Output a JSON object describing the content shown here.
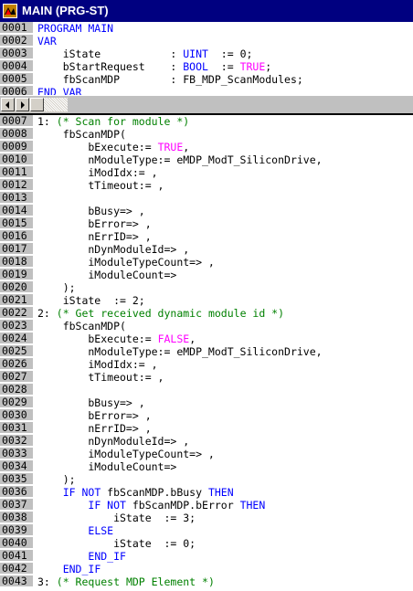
{
  "window": {
    "title": "MAIN (PRG-ST)"
  },
  "colors": {
    "keyword": "#0000ff",
    "literal": "#ff00ff",
    "comment": "#008000",
    "title_bar": "#000080",
    "gutter": "#c0c0c0"
  },
  "declaration": {
    "lines": [
      {
        "n": "0001",
        "seg": [
          {
            "t": "PROGRAM MAIN",
            "c": "kw"
          }
        ]
      },
      {
        "n": "0002",
        "seg": [
          {
            "t": "VAR",
            "c": "kw"
          }
        ]
      },
      {
        "n": "0003",
        "seg": [
          {
            "t": "    iState           : "
          },
          {
            "t": "UINT",
            "c": "kw"
          },
          {
            "t": "  := 0;"
          }
        ]
      },
      {
        "n": "0004",
        "seg": [
          {
            "t": "    bStartRequest    : "
          },
          {
            "t": "BOOL",
            "c": "kw"
          },
          {
            "t": "  := "
          },
          {
            "t": "TRUE",
            "c": "tru"
          },
          {
            "t": ";"
          }
        ]
      },
      {
        "n": "0005",
        "seg": [
          {
            "t": "    fbScanMDP        : FB_MDP_ScanModules;"
          }
        ]
      },
      {
        "n": "0006",
        "seg": [
          {
            "t": "END_VAR",
            "c": "kw"
          }
        ]
      }
    ]
  },
  "body": {
    "lines": [
      {
        "n": "0007",
        "seg": [
          {
            "t": "1: "
          },
          {
            "t": "(* Scan for module *)",
            "c": "cmt"
          }
        ]
      },
      {
        "n": "0008",
        "seg": [
          {
            "t": "    fbScanMDP("
          }
        ]
      },
      {
        "n": "0009",
        "seg": [
          {
            "t": "        bExecute:= "
          },
          {
            "t": "TRUE",
            "c": "tru"
          },
          {
            "t": ","
          }
        ]
      },
      {
        "n": "0010",
        "seg": [
          {
            "t": "        nModuleType:= eMDP_ModT_SiliconDrive,"
          }
        ]
      },
      {
        "n": "0011",
        "seg": [
          {
            "t": "        iModIdx:= ,"
          }
        ]
      },
      {
        "n": "0012",
        "seg": [
          {
            "t": "        tTimeout:= ,"
          }
        ]
      },
      {
        "n": "0013",
        "seg": [
          {
            "t": ""
          }
        ]
      },
      {
        "n": "0014",
        "seg": [
          {
            "t": "        bBusy=> ,"
          }
        ]
      },
      {
        "n": "0015",
        "seg": [
          {
            "t": "        bError=> ,"
          }
        ]
      },
      {
        "n": "0016",
        "seg": [
          {
            "t": "        nErrID=> ,"
          }
        ]
      },
      {
        "n": "0017",
        "seg": [
          {
            "t": "        nDynModuleId=> ,"
          }
        ]
      },
      {
        "n": "0018",
        "seg": [
          {
            "t": "        iModuleTypeCount=> ,"
          }
        ]
      },
      {
        "n": "0019",
        "seg": [
          {
            "t": "        iModuleCount=>"
          }
        ]
      },
      {
        "n": "0020",
        "seg": [
          {
            "t": "    );"
          }
        ]
      },
      {
        "n": "0021",
        "seg": [
          {
            "t": "    iState  := 2;"
          }
        ]
      },
      {
        "n": "0022",
        "seg": [
          {
            "t": "2: "
          },
          {
            "t": "(* Get received dynamic module id *)",
            "c": "cmt"
          }
        ]
      },
      {
        "n": "0023",
        "seg": [
          {
            "t": "    fbScanMDP("
          }
        ]
      },
      {
        "n": "0024",
        "seg": [
          {
            "t": "        bExecute:= "
          },
          {
            "t": "FALSE",
            "c": "tru"
          },
          {
            "t": ","
          }
        ]
      },
      {
        "n": "0025",
        "seg": [
          {
            "t": "        nModuleType:= eMDP_ModT_SiliconDrive,"
          }
        ]
      },
      {
        "n": "0026",
        "seg": [
          {
            "t": "        iModIdx:= ,"
          }
        ]
      },
      {
        "n": "0027",
        "seg": [
          {
            "t": "        tTimeout:= ,"
          }
        ]
      },
      {
        "n": "0028",
        "seg": [
          {
            "t": ""
          }
        ]
      },
      {
        "n": "0029",
        "seg": [
          {
            "t": "        bBusy=> ,"
          }
        ]
      },
      {
        "n": "0030",
        "seg": [
          {
            "t": "        bError=> ,"
          }
        ]
      },
      {
        "n": "0031",
        "seg": [
          {
            "t": "        nErrID=> ,"
          }
        ]
      },
      {
        "n": "0032",
        "seg": [
          {
            "t": "        nDynModuleId=> ,"
          }
        ]
      },
      {
        "n": "0033",
        "seg": [
          {
            "t": "        iModuleTypeCount=> ,"
          }
        ]
      },
      {
        "n": "0034",
        "seg": [
          {
            "t": "        iModuleCount=>"
          }
        ]
      },
      {
        "n": "0035",
        "seg": [
          {
            "t": "    );"
          }
        ]
      },
      {
        "n": "0036",
        "seg": [
          {
            "t": "    "
          },
          {
            "t": "IF NOT",
            "c": "kw"
          },
          {
            "t": " fbScanMDP.bBusy "
          },
          {
            "t": "THEN",
            "c": "kw"
          }
        ]
      },
      {
        "n": "0037",
        "seg": [
          {
            "t": "        "
          },
          {
            "t": "IF NOT",
            "c": "kw"
          },
          {
            "t": " fbScanMDP.bError "
          },
          {
            "t": "THEN",
            "c": "kw"
          }
        ]
      },
      {
        "n": "0038",
        "seg": [
          {
            "t": "            iState  := 3;"
          }
        ]
      },
      {
        "n": "0039",
        "seg": [
          {
            "t": "        "
          },
          {
            "t": "ELSE",
            "c": "kw"
          }
        ]
      },
      {
        "n": "0040",
        "seg": [
          {
            "t": "            iState  := 0;"
          }
        ]
      },
      {
        "n": "0041",
        "seg": [
          {
            "t": "        "
          },
          {
            "t": "END_IF",
            "c": "kw"
          }
        ]
      },
      {
        "n": "0042",
        "seg": [
          {
            "t": "    "
          },
          {
            "t": "END_IF",
            "c": "kw"
          }
        ]
      },
      {
        "n": "0043",
        "seg": [
          {
            "t": "3: "
          },
          {
            "t": "(* Request MDP Element *)",
            "c": "cmt"
          }
        ]
      }
    ]
  }
}
